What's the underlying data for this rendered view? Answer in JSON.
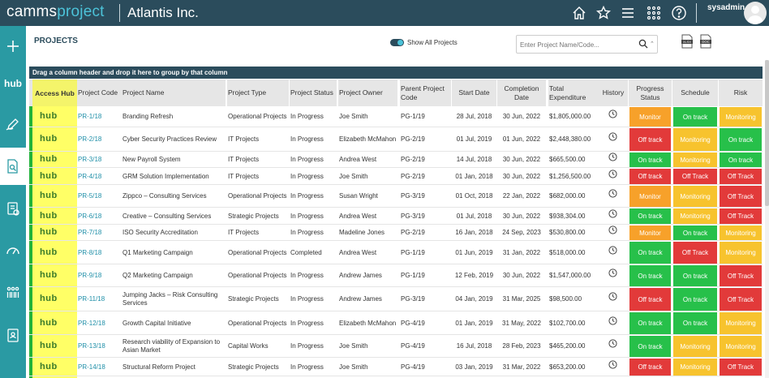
{
  "app": {
    "logo_part1": "camms",
    "logo_part2": "project",
    "company": "Atlantis Inc.",
    "username": "sysadmin"
  },
  "topbar_icons": [
    "home-icon",
    "star-icon",
    "menu-icon",
    "apps-grid-icon",
    "help-icon"
  ],
  "sidebar": {
    "hub_label": "hub",
    "items": [
      "add-icon",
      "hub-icon",
      "edit-icon",
      "document-search-icon",
      "report-icon",
      "dashboard-gauge-icon",
      "people-icon",
      "contacts-icon"
    ]
  },
  "page": {
    "title": "PROJECTS",
    "toggle_label": "Show All Projects",
    "toggle_on": true,
    "search_placeholder": "Enter Project Name/Code...",
    "export_xlsx": "XLSX",
    "export_doc": "DOC",
    "group_hint": "Drag a column header and drop it here to group by that column"
  },
  "columns": {
    "hub": "Access Hub",
    "code": "Project Code",
    "name": "Project Name",
    "type": "Project Type",
    "status": "Project Status",
    "owner": "Project Owner",
    "parent": "Parent Project Code",
    "start": "Start Date",
    "completion": "Completion Date",
    "expenditure": "Total Expenditure",
    "history": "History",
    "progress": "Progress Status",
    "schedule": "Schedule",
    "risk": "Risk"
  },
  "status_colors": {
    "Monitor": "#f7a12a",
    "Off track": "#e23a3a",
    "Off Track": "#e23a3a",
    "On track": "#27c04a",
    "Monitoring": "#f7c32e"
  },
  "rows": [
    {
      "hub": "hub",
      "code": "PR-1/18",
      "name": "Branding Refresh",
      "type": "Operational Projects",
      "status": "In Progress",
      "owner": "Joe Smith",
      "parent": "PG-1/19",
      "start": "28 Jul, 2018",
      "completion": "30 Jun, 2022",
      "expenditure": "$1,805,000.00",
      "progress": "Monitor",
      "schedule": "On track",
      "risk": "Monitoring"
    },
    {
      "hub": "hub",
      "code": "PR-2/18",
      "name": "Cyber Security Practices Review",
      "type": "IT Projects",
      "status": "In Progress",
      "owner": "Elizabeth McMahon",
      "parent": "PG-2/19",
      "start": "01 Jul, 2019",
      "completion": "01 Jun, 2022",
      "expenditure": "$2,448,380.00",
      "progress": "Off track",
      "schedule": "Monitoring",
      "risk": "On track"
    },
    {
      "hub": "hub",
      "code": "PR-3/18",
      "name": "New Payroll System",
      "type": "IT Projects",
      "status": "In Progress",
      "owner": "Andrea West",
      "parent": "PG-2/19",
      "start": "14 Jul, 2018",
      "completion": "30 Jun, 2022",
      "expenditure": "$665,500.00",
      "progress": "On track",
      "schedule": "Monitoring",
      "risk": "On track"
    },
    {
      "hub": "hub",
      "code": "PR-4/18",
      "name": "GRM Solution Implementation",
      "type": "IT Projects",
      "status": "In Progress",
      "owner": "Joe Smith",
      "parent": "PG-2/19",
      "start": "01 Jan, 2018",
      "completion": "30 Jun, 2022",
      "expenditure": "$1,256,500.00",
      "progress": "Off track",
      "schedule": "Off Track",
      "risk": "Off Track"
    },
    {
      "hub": "hub",
      "code": "PR-5/18",
      "name": "Zippco – Consulting Services",
      "type": "Operational Projects",
      "status": "In Progress",
      "owner": "Susan Wright",
      "parent": "PG-3/19",
      "start": "01 Oct, 2018",
      "completion": "22 Jan, 2022",
      "expenditure": "$682,000.00",
      "progress": "Monitor",
      "schedule": "Monitoring",
      "risk": "Off Track"
    },
    {
      "hub": "hub",
      "code": "PR-6/18",
      "name": "Creative – Consulting Services",
      "type": "Strategic Projects",
      "status": "In Progress",
      "owner": "Andrea West",
      "parent": "PG-3/19",
      "start": "01 Jul, 2018",
      "completion": "30 Jun, 2022",
      "expenditure": "$938,304.00",
      "progress": "On track",
      "schedule": "Monitoring",
      "risk": "Off Track"
    },
    {
      "hub": "hub",
      "code": "PR-7/18",
      "name": "ISO Security Accreditation",
      "type": "IT Projects",
      "status": "In Progress",
      "owner": "Madeline Jones",
      "parent": "PG-2/19",
      "start": "16 Jan, 2018",
      "completion": "24 Sep, 2023",
      "expenditure": "$530,800.00",
      "progress": "Monitor",
      "schedule": "On track",
      "risk": "Monitoring"
    },
    {
      "hub": "hub",
      "code": "PR-8/18",
      "name": "Q1 Marketing Campaign",
      "type": "Operational Projects",
      "status": "Completed",
      "owner": "Andrea West",
      "parent": "PG-1/19",
      "start": "01 Jun, 2019",
      "completion": "31 Jan, 2022",
      "expenditure": "$518,000.00",
      "progress": "On track",
      "schedule": "Off Track",
      "risk": "Monitoring"
    },
    {
      "hub": "hub",
      "code": "PR-9/18",
      "name": "Q2 Marketing Campaign",
      "type": "Operational Projects",
      "status": "In Progress",
      "owner": "Andrew James",
      "parent": "PG-1/19",
      "start": "12 Feb, 2019",
      "completion": "30 Jun, 2022",
      "expenditure": "$1,547,000.00",
      "progress": "On track",
      "schedule": "On track",
      "risk": "Off Track"
    },
    {
      "hub": "hub",
      "code": "PR-11/18",
      "name": "Jumping Jacks – Risk Consulting Services",
      "type": "Strategic Projects",
      "status": "In Progress",
      "owner": "Andrew James",
      "parent": "PG-3/19",
      "start": "04 Jan, 2019",
      "completion": "31 Mar, 2025",
      "expenditure": "$98,500.00",
      "progress": "Off track",
      "schedule": "On track",
      "risk": "Off Track"
    },
    {
      "hub": "hub",
      "code": "PR-12/18",
      "name": "Growth Capital Initiative",
      "type": "Operational Projects",
      "status": "In Progress",
      "owner": "Elizabeth McMahon",
      "parent": "PG-4/19",
      "start": "01 Jan, 2019",
      "completion": "31 May, 2022",
      "expenditure": "$102,700.00",
      "progress": "On track",
      "schedule": "On track",
      "risk": "Monitoring"
    },
    {
      "hub": "hub",
      "code": "PR-13/18",
      "name": "Research viability of Expansion to Asian Market",
      "type": "Capital Works",
      "status": "In Progress",
      "owner": "Joe Smith",
      "parent": "PG-4/19",
      "start": "16 Jul, 2018",
      "completion": "28 Feb, 2023",
      "expenditure": "$465,200.00",
      "progress": "On track",
      "schedule": "Monitoring",
      "risk": "Monitoring"
    },
    {
      "hub": "hub",
      "code": "PR-14/18",
      "name": "Structural Reform Project",
      "type": "Strategic Projects",
      "status": "In Progress",
      "owner": "Joe Smith",
      "parent": "PG-4/19",
      "start": "03 Jan, 2019",
      "completion": "31 Mar, 2022",
      "expenditure": "$653,200.00",
      "progress": "Off track",
      "schedule": "Monitoring",
      "risk": "Off Track"
    }
  ]
}
